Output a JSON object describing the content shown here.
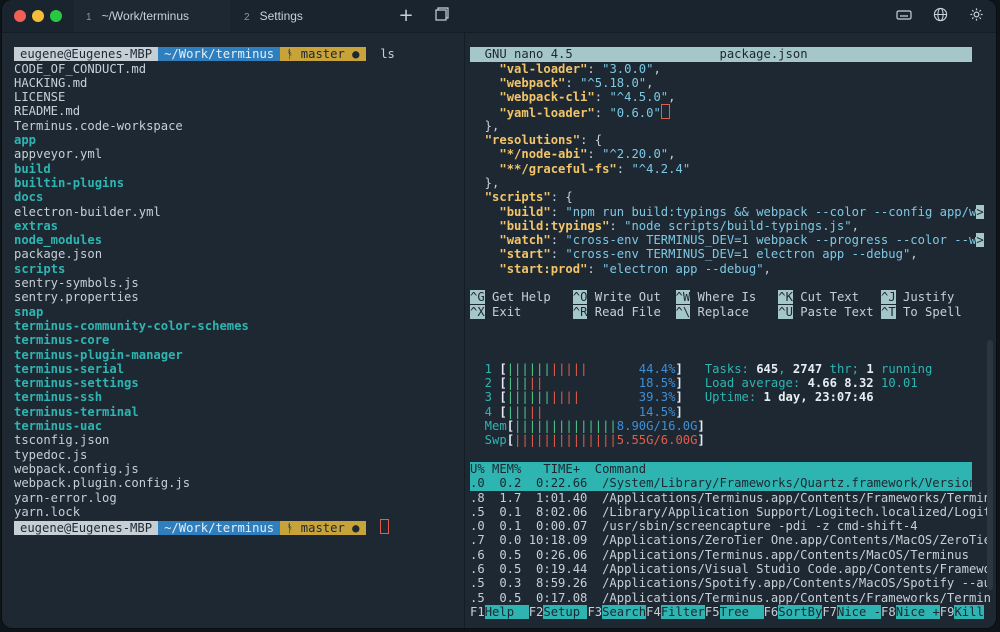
{
  "tabs": [
    {
      "num": "1",
      "label": "~/Work/terminus"
    },
    {
      "num": "2",
      "label": "Settings"
    }
  ],
  "toolbar": {
    "new_tab": "+",
    "colors": {
      "close": "#f25f57",
      "minimize": "#f6bd3b",
      "zoom": "#28c841"
    }
  },
  "left_pane": {
    "prompt": {
      "user": "eugene@Eugenes-MBP",
      "path": "~/Work/terminus",
      "branch": "ᚬ master ●",
      "cmd": "ls"
    },
    "files": [
      {
        "name": "CODE_OF_CONDUCT.md",
        "dir": false
      },
      {
        "name": "HACKING.md",
        "dir": false
      },
      {
        "name": "LICENSE",
        "dir": false
      },
      {
        "name": "README.md",
        "dir": false
      },
      {
        "name": "Terminus.code-workspace",
        "dir": false
      },
      {
        "name": "app",
        "dir": true
      },
      {
        "name": "appveyor.yml",
        "dir": false
      },
      {
        "name": "build",
        "dir": true
      },
      {
        "name": "builtin-plugins",
        "dir": true
      },
      {
        "name": "docs",
        "dir": true
      },
      {
        "name": "electron-builder.yml",
        "dir": false
      },
      {
        "name": "extras",
        "dir": true
      },
      {
        "name": "node_modules",
        "dir": true
      },
      {
        "name": "package.json",
        "dir": false
      },
      {
        "name": "scripts",
        "dir": true
      },
      {
        "name": "sentry-symbols.js",
        "dir": false
      },
      {
        "name": "sentry.properties",
        "dir": false
      },
      {
        "name": "snap",
        "dir": true
      },
      {
        "name": "terminus-community-color-schemes",
        "dir": true
      },
      {
        "name": "terminus-core",
        "dir": true
      },
      {
        "name": "terminus-plugin-manager",
        "dir": true
      },
      {
        "name": "terminus-serial",
        "dir": true
      },
      {
        "name": "terminus-settings",
        "dir": true
      },
      {
        "name": "terminus-ssh",
        "dir": true
      },
      {
        "name": "terminus-terminal",
        "dir": true
      },
      {
        "name": "terminus-uac",
        "dir": true
      },
      {
        "name": "tsconfig.json",
        "dir": false
      },
      {
        "name": "typedoc.js",
        "dir": false
      },
      {
        "name": "webpack.config.js",
        "dir": false
      },
      {
        "name": "webpack.plugin.config.js",
        "dir": false
      },
      {
        "name": "yarn-error.log",
        "dir": false
      },
      {
        "name": "yarn.lock",
        "dir": false
      }
    ]
  },
  "nano": {
    "title_left": "  GNU nano 4.5",
    "title_center": "package.json",
    "lines": [
      [
        [
          "    ",
          ""
        ],
        [
          "\"val-loader\"",
          "key"
        ],
        [
          ": ",
          ""
        ],
        [
          "\"3.0.0\"",
          "str"
        ],
        [
          ",",
          ""
        ]
      ],
      [
        [
          "    ",
          ""
        ],
        [
          "\"webpack\"",
          "key"
        ],
        [
          ": ",
          ""
        ],
        [
          "\"^5.18.0\"",
          "str"
        ],
        [
          ",",
          ""
        ]
      ],
      [
        [
          "    ",
          ""
        ],
        [
          "\"webpack-cli\"",
          "key"
        ],
        [
          ": ",
          ""
        ],
        [
          "\"^4.5.0\"",
          "str"
        ],
        [
          ",",
          ""
        ]
      ],
      [
        [
          "    ",
          ""
        ],
        [
          "\"yaml-loader\"",
          "key"
        ],
        [
          ": ",
          ""
        ],
        [
          "\"0.6.0\"",
          "str"
        ]
      ],
      [
        [
          "  },",
          ""
        ]
      ],
      [
        [
          "  ",
          ""
        ],
        [
          "\"resolutions\"",
          "key"
        ],
        [
          ": {",
          ""
        ]
      ],
      [
        [
          "    ",
          ""
        ],
        [
          "\"*/node-abi\"",
          "key"
        ],
        [
          ": ",
          ""
        ],
        [
          "\"^2.20.0\"",
          "str"
        ],
        [
          ",",
          ""
        ]
      ],
      [
        [
          "    ",
          ""
        ],
        [
          "\"**/graceful-fs\"",
          "key"
        ],
        [
          ": ",
          ""
        ],
        [
          "\"^4.2.4\"",
          "str"
        ]
      ],
      [
        [
          "  },",
          ""
        ]
      ],
      [
        [
          "  ",
          ""
        ],
        [
          "\"scripts\"",
          "key"
        ],
        [
          ": {",
          ""
        ]
      ],
      [
        [
          "    ",
          ""
        ],
        [
          "\"build\"",
          "key"
        ],
        [
          ": ",
          ""
        ],
        [
          "\"npm run build:typings && webpack --color --config app/w",
          "str"
        ],
        [
          ">",
          "nk"
        ]
      ],
      [
        [
          "    ",
          ""
        ],
        [
          "\"build:typings\"",
          "key"
        ],
        [
          ": ",
          ""
        ],
        [
          "\"node scripts/build-typings.js\"",
          "str"
        ],
        [
          ",",
          ""
        ]
      ],
      [
        [
          "    ",
          ""
        ],
        [
          "\"watch\"",
          "key"
        ],
        [
          ": ",
          ""
        ],
        [
          "\"cross-env TERMINUS_DEV=1 webpack --progress --color --w",
          "str"
        ],
        [
          ">",
          "nk"
        ]
      ],
      [
        [
          "    ",
          ""
        ],
        [
          "\"start\"",
          "key"
        ],
        [
          ": ",
          ""
        ],
        [
          "\"cross-env TERMINUS_DEV=1 electron app --debug\"",
          "str"
        ],
        [
          ",",
          ""
        ]
      ],
      [
        [
          "    ",
          ""
        ],
        [
          "\"start:prod\"",
          "key"
        ],
        [
          ": ",
          ""
        ],
        [
          "\"electron app --debug\"",
          "str"
        ],
        [
          ",",
          ""
        ]
      ]
    ],
    "shortcuts_row1": [
      [
        "^G",
        "Get Help"
      ],
      [
        "^O",
        "Write Out"
      ],
      [
        "^W",
        "Where Is"
      ],
      [
        "^K",
        "Cut Text"
      ],
      [
        "^J",
        "Justify"
      ]
    ],
    "shortcuts_row2": [
      [
        "^X",
        "Exit"
      ],
      [
        "^R",
        "Read File"
      ],
      [
        "^\\",
        "Replace"
      ],
      [
        "^U",
        "Paste Text"
      ],
      [
        "^T",
        "To Spell"
      ]
    ]
  },
  "htop": {
    "cpus": [
      {
        "n": "1",
        "green": "||||||",
        "red": "|||||",
        "pct": "44.4%"
      },
      {
        "n": "2",
        "green": "|||",
        "red": "||",
        "pct": "18.5%"
      },
      {
        "n": "3",
        "green": "||||||",
        "red": "||||",
        "pct": "39.3%"
      },
      {
        "n": "4",
        "green": "|||",
        "red": "||",
        "pct": "14.5%"
      }
    ],
    "mem": {
      "label": "Mem",
      "bar": "||||||||||||||",
      "value": "8.90G/16.0G"
    },
    "swp": {
      "label": "Swp",
      "bar": "||||||||||||||",
      "value": "5.55G/6.00G"
    },
    "tasks": {
      "label": "Tasks: ",
      "count": "645",
      "sep": ", ",
      "thr": "2747",
      "thr_label": " thr; ",
      "running": "1",
      "running_label": " running"
    },
    "load": {
      "label": "Load average: ",
      "v1": "4.66",
      "v2": "8.32",
      "v3": "10.01"
    },
    "uptime": {
      "label": "Uptime: ",
      "value": "1 day, 23:07:46"
    },
    "header": "U% MEM%   TIME+  Command",
    "rows": [
      ".0  0.2  0:22.66  /System/Library/Frameworks/Quartz.framework/Versions/",
      ".8  1.7  1:01.40  /Applications/Terminus.app/Contents/Frameworks/Termin",
      ".5  0.1  8:02.06  /Library/Application Support/Logitech.localized/Logit",
      ".0  0.1  0:00.07  /usr/sbin/screencapture -pdi -z cmd-shift-4",
      ".7  0.0 10:18.09  /Applications/ZeroTier One.app/Contents/MacOS/ZeroTie",
      ".6  0.5  0:26.06  /Applications/Terminus.app/Contents/MacOS/Terminus",
      ".6  0.5  0:19.44  /Applications/Visual Studio Code.app/Contents/Framewo",
      ".5  0.3  8:59.26  /Applications/Spotify.app/Contents/MacOS/Spotify --au",
      ".5  0.5  0:17.08  /Applications/Terminus.app/Contents/Frameworks/Termin"
    ],
    "fkeys": [
      [
        "F1",
        "Help  "
      ],
      [
        "F2",
        "Setup "
      ],
      [
        "F3",
        "Search"
      ],
      [
        "F4",
        "Filter"
      ],
      [
        "F5",
        "Tree  "
      ],
      [
        "F6",
        "SortBy"
      ],
      [
        "F7",
        "Nice -"
      ],
      [
        "F8",
        "Nice +"
      ],
      [
        "F9",
        "Kill"
      ]
    ]
  }
}
